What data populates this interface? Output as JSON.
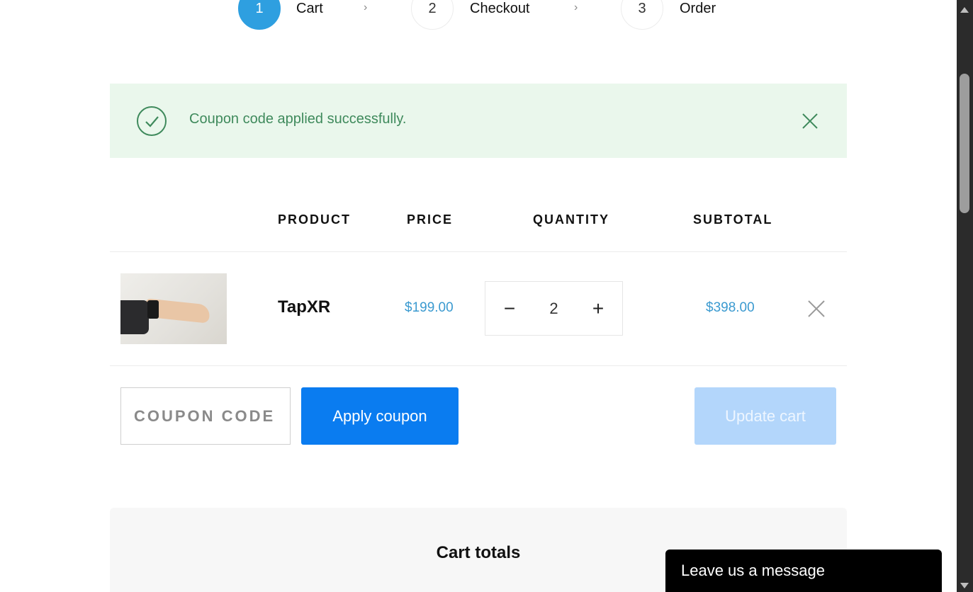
{
  "steps": [
    {
      "number": "1",
      "label": "Cart"
    },
    {
      "number": "2",
      "label": "Checkout"
    },
    {
      "number": "3",
      "label": "Order"
    }
  ],
  "step_separator": "›",
  "notice": {
    "message": "Coupon code applied successfully.",
    "icon": "check-circle-icon",
    "close_icon": "close-icon"
  },
  "table": {
    "headers": {
      "product": "PRODUCT",
      "price": "PRICE",
      "quantity": "QUANTITY",
      "subtotal": "SUBTOTAL"
    },
    "rows": [
      {
        "name": "TapXR",
        "price": "$199.00",
        "quantity": "2",
        "subtotal": "$398.00",
        "decrement": "−",
        "increment": "+"
      }
    ]
  },
  "coupon": {
    "placeholder": "COUPON CODE",
    "value": "",
    "apply_label": "Apply coupon"
  },
  "update_label": "Update cart",
  "totals": {
    "title": "Cart totals"
  },
  "chat": {
    "label": "Leave us a message"
  },
  "colors": {
    "accent": "#2e9fe0",
    "button": "#0a7cf0",
    "button_disabled": "#b3d6fb",
    "notice_bg": "#eaf7ec",
    "notice_text": "#3f8a5c",
    "price": "#3b9ad0"
  }
}
